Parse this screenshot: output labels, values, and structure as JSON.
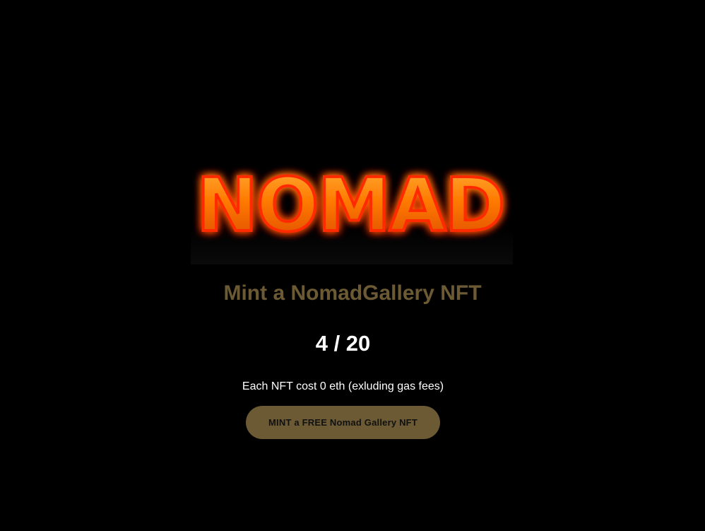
{
  "logo": {
    "text": "NOMAD",
    "glow_color": "#ff2a00",
    "fill_color": "#ff7a00"
  },
  "heading": {
    "title": "Mint a NomadGallery NFT"
  },
  "counter": {
    "minted": 4,
    "total": 20,
    "display": "4 / 20"
  },
  "info": {
    "cost_text": "Each NFT cost 0 eth (exluding gas fees)"
  },
  "mint": {
    "button_label": "MINT a FREE Nomad Gallery NFT"
  },
  "colors": {
    "background": "#000000",
    "accent": "#6b5a33",
    "text": "#ffffff"
  }
}
